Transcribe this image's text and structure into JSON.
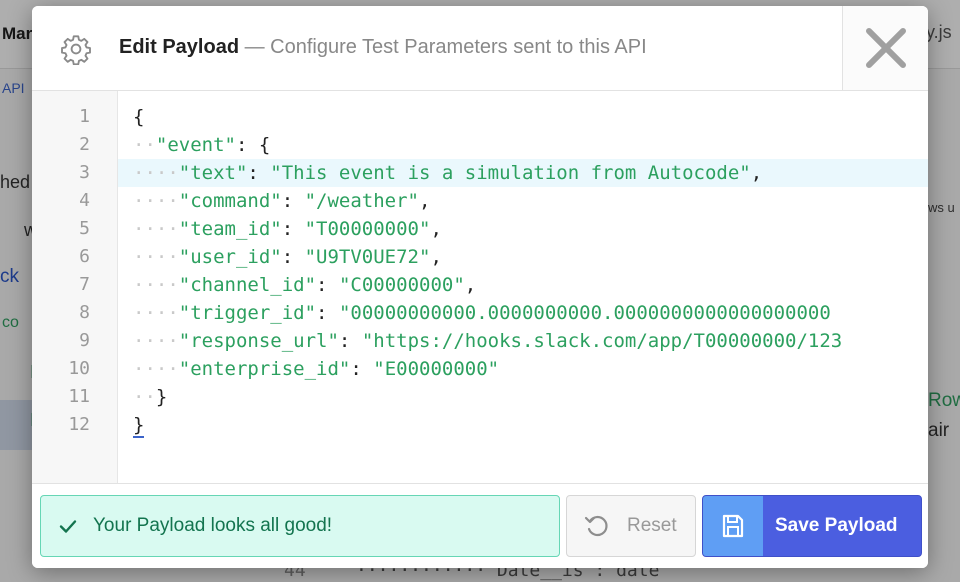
{
  "background": {
    "app_title": "Mar",
    "file_tab": "ly.js",
    "api_label": "API",
    "sidebar": [
      "hed",
      "w",
      "ck",
      "co",
      "I",
      "I"
    ],
    "right_fragments": [
      "ws u",
      "Row",
      "air"
    ],
    "bottom_line_number": "44",
    "bottom_line_code": "············\"Date__is\": date"
  },
  "modal": {
    "icon": "gear-icon",
    "title": "Edit Payload",
    "subtitle": " — Configure Test Parameters sent to this API",
    "close_icon": "close-icon"
  },
  "editor": {
    "line_numbers": [
      "1",
      "2",
      "3",
      "4",
      "5",
      "6",
      "7",
      "8",
      "9",
      "10",
      "11",
      "12"
    ],
    "active_line": 3,
    "lines": [
      {
        "indent": "",
        "key": "",
        "value": "",
        "punc": "{"
      },
      {
        "indent": "··",
        "key": "\"event\"",
        "value": "",
        "punc": ": {"
      },
      {
        "indent": "····",
        "key": "\"text\"",
        "value": "\"This event is a simulation from Autocode\"",
        "punc": ","
      },
      {
        "indent": "····",
        "key": "\"command\"",
        "value": "\"/weather\"",
        "punc": ","
      },
      {
        "indent": "····",
        "key": "\"team_id\"",
        "value": "\"T00000000\"",
        "punc": ","
      },
      {
        "indent": "····",
        "key": "\"user_id\"",
        "value": "\"U9TV0UE72\"",
        "punc": ","
      },
      {
        "indent": "····",
        "key": "\"channel_id\"",
        "value": "\"C00000000\"",
        "punc": ","
      },
      {
        "indent": "····",
        "key": "\"trigger_id\"",
        "value": "\"00000000000.0000000000.0000000000000000000",
        "punc": ""
      },
      {
        "indent": "····",
        "key": "\"response_url\"",
        "value": "\"https://hooks.slack.com/app/T00000000/123",
        "punc": ""
      },
      {
        "indent": "····",
        "key": "\"enterprise_id\"",
        "value": "\"E00000000\"",
        "punc": ""
      },
      {
        "indent": "··",
        "key": "",
        "value": "",
        "punc": "}"
      },
      {
        "indent": "",
        "key": "",
        "value": "",
        "punc": "}"
      }
    ],
    "status_color": "#17b58a"
  },
  "footer": {
    "status_icon": "check-icon",
    "status_text": "Your Payload looks all good!",
    "reset_icon": "undo-icon",
    "reset_label": "Reset",
    "save_icon": "save-icon",
    "save_label": "Save Payload"
  },
  "colors": {
    "json_key": "#2ca05f",
    "primary": "#4b5ee0",
    "success_bg": "#d9faf1"
  }
}
